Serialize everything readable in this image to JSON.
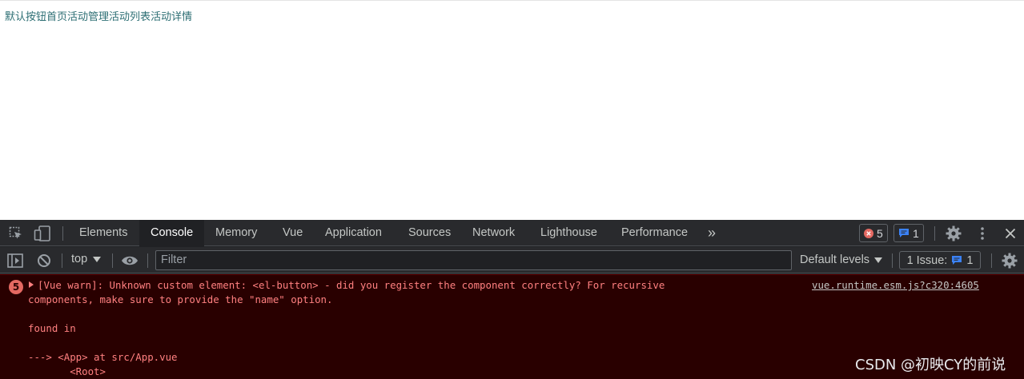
{
  "page": {
    "items": [
      "默认按钮",
      "首页",
      "活动管理",
      "活动列表",
      "活动详情"
    ]
  },
  "devtools": {
    "tabs": [
      "Elements",
      "Console",
      "Memory",
      "Vue",
      "Application",
      "Sources",
      "Network",
      "Lighthouse",
      "Performance"
    ],
    "active_tab": "Console",
    "more_tabs_glyph": "»",
    "error_count": "5",
    "message_count": "1",
    "toolbar": {
      "context": "top",
      "filter_placeholder": "Filter",
      "levels": "Default levels",
      "issues_label": "1 Issue:",
      "issues_count": "1"
    },
    "console": {
      "repeat_count": "5",
      "line1": "[Vue warn]: Unknown custom element: <el-button> - did you register the component correctly? For recursive",
      "line2": "components, make sure to provide the \"name\" option.",
      "line3": "found in",
      "line4": "---> <App> at src/App.vue",
      "line5": "       <Root>",
      "source": "vue.runtime.esm.js?c320:4605"
    }
  },
  "watermark": "CSDN @初映CY的前说",
  "colors": {
    "page_text": "#2c6e73",
    "devtools_bg": "#202124",
    "toolbar_bg": "#292a2d",
    "error_bg": "#290000",
    "error_text": "#ff8080",
    "error_badge": "#e46962",
    "issue_blue": "#3b82f6"
  }
}
